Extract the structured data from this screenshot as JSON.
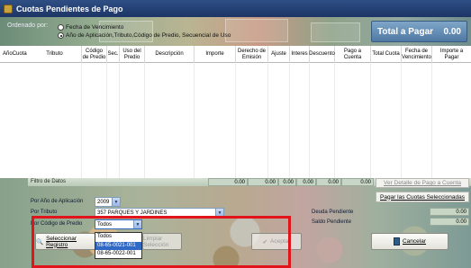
{
  "window": {
    "title": "Cuotas Pendientes de Pago"
  },
  "banner": {
    "ordenado_label": "Ordenado por:",
    "radio_options": [
      {
        "label": "Fecha de Vencimiento",
        "selected": false
      },
      {
        "label": "Año de Aplicación,Tributo,Código de Predio, Secuencial de Uso",
        "selected": true
      }
    ],
    "total_label": "Total a Pagar",
    "total_value": "0.00"
  },
  "grid": {
    "columns": [
      "Año",
      "Cuota",
      "Tributo",
      "Código de Predio",
      "Sec.",
      "Uso del Predio",
      "Descripción",
      "Importe",
      "Derecho de Emisión",
      "Ajuste",
      "Interes",
      "Descuento",
      "Pago a Cuenta",
      "Total Cuota",
      "Fecha de Vencimiento",
      "Importe a Pagar"
    ]
  },
  "filters": {
    "filtro_label": "Filtro de Datos",
    "anio_label": "Por Año de Aplicación",
    "anio_value": "2009",
    "tributo_label": "Por Tributo",
    "tributo_value": "357 PARQUES Y JARDINES",
    "codigo_label": "Por Código de Predio",
    "codigo_value": "Todos",
    "codigo_options": [
      "Todos",
      "08-65-0021-001",
      "08-65-0022-001"
    ]
  },
  "totals": {
    "importe": "0.00",
    "derecho": "0.00",
    "ajuste": "0.00",
    "interes": "0.00",
    "descuento": "0.00",
    "pago_cuenta": "0.00"
  },
  "actions": {
    "ver_detalle": "Ver Detalle de Pago a Cuenta",
    "pagar_seleccionadas": "Pagar las Cuotas Seleccionadas",
    "deuda_pendiente_label": "Deuda Pendiente",
    "deuda_pendiente_value": "0.00",
    "saldo_pendiente_label": "Saldo Pendiente",
    "saldo_pendiente_value": "0.00",
    "seleccionar_label": "Seleccionar Registro",
    "limpiar_label": "Limpiar Selección",
    "aceptar_label": "Aceptar",
    "cancelar_label": "Cancelar"
  },
  "colors": {
    "titlebar": "#1d3566",
    "highlight": "#e0141a",
    "selection": "#316ac5"
  }
}
